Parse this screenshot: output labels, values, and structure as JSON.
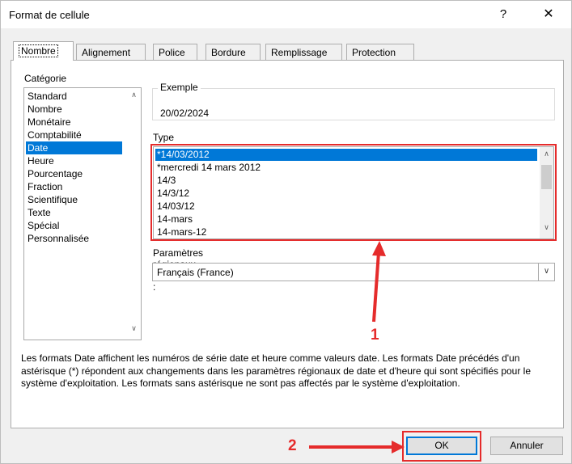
{
  "window": {
    "title": "Format de cellule",
    "help_label": "?",
    "close_label": "✕"
  },
  "tabs": [
    {
      "label": "Nombre",
      "active": true
    },
    {
      "label": "Alignement"
    },
    {
      "label": "Police"
    },
    {
      "label": "Bordure"
    },
    {
      "label": "Remplissage"
    },
    {
      "label": "Protection"
    }
  ],
  "category": {
    "label": "Catégorie :",
    "items": [
      "Standard",
      "Nombre",
      "Monétaire",
      "Comptabilité",
      "Date",
      "Heure",
      "Pourcentage",
      "Fraction",
      "Scientifique",
      "Texte",
      "Spécial",
      "Personnalisée"
    ],
    "selected": "Date"
  },
  "sample": {
    "label": "Exemple",
    "value": "20/02/2024"
  },
  "type": {
    "label": "Type :",
    "items": [
      "*14/03/2012",
      "*mercredi 14 mars 2012",
      "14/3",
      "14/3/12",
      "14/03/12",
      "14-mars",
      "14-mars-12"
    ],
    "selected": "*14/03/2012"
  },
  "locale": {
    "label": "Paramètres régionaux (emplacement) :",
    "value": "Français (France)"
  },
  "description": "Les formats Date affichent les numéros de série date et heure comme valeurs date. Les formats Date précédés d'un astérisque (*) répondent aux changements dans les paramètres régionaux de date et d'heure qui sont spécifiés pour le système d'exploitation. Les formats sans astérisque ne sont pas affectés par le système d'exploitation.",
  "buttons": {
    "ok": "OK",
    "cancel": "Annuler"
  },
  "annotations": {
    "marker1": "1",
    "marker2": "2",
    "color": "#e52b2b"
  },
  "colors": {
    "selection": "#0078d7",
    "dialog_bg": "#f0f0f0"
  }
}
